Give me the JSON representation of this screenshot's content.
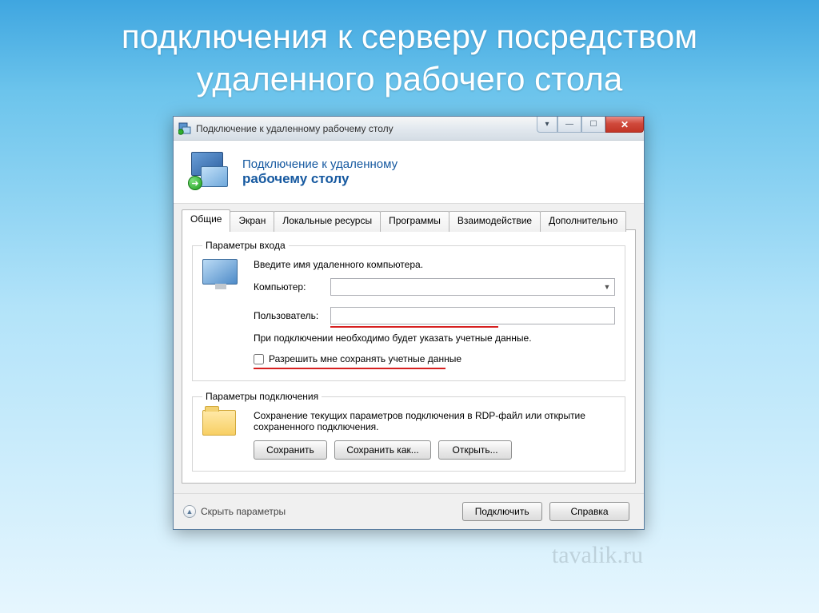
{
  "slide": {
    "title": "подключения к серверу посредством удаленного рабочего стола"
  },
  "window": {
    "title": "Подключение к удаленному рабочему столу",
    "banner": {
      "line1": "Подключение к удаленному",
      "line2": "рабочему столу"
    },
    "tabs": [
      {
        "label": "Общие",
        "active": true
      },
      {
        "label": "Экран",
        "active": false
      },
      {
        "label": "Локальные ресурсы",
        "active": false
      },
      {
        "label": "Программы",
        "active": false
      },
      {
        "label": "Взаимодействие",
        "active": false
      },
      {
        "label": "Дополнительно",
        "active": false
      }
    ],
    "login": {
      "legend": "Параметры входа",
      "instruction": "Введите имя удаленного компьютера.",
      "computer_label": "Компьютер:",
      "computer_value": "",
      "user_label": "Пользователь:",
      "user_value": "",
      "note": "При подключении необходимо будет указать учетные данные.",
      "save_creds_label": "Разрешить мне сохранять учетные данные"
    },
    "params": {
      "legend": "Параметры подключения",
      "desc": "Сохранение текущих параметров подключения в RDP-файл или открытие сохраненного подключения.",
      "save": "Сохранить",
      "save_as": "Сохранить как...",
      "open": "Открыть..."
    },
    "footer": {
      "hide": "Скрыть параметры",
      "connect": "Подключить",
      "help": "Справка"
    }
  },
  "watermark": "tavalik.ru"
}
